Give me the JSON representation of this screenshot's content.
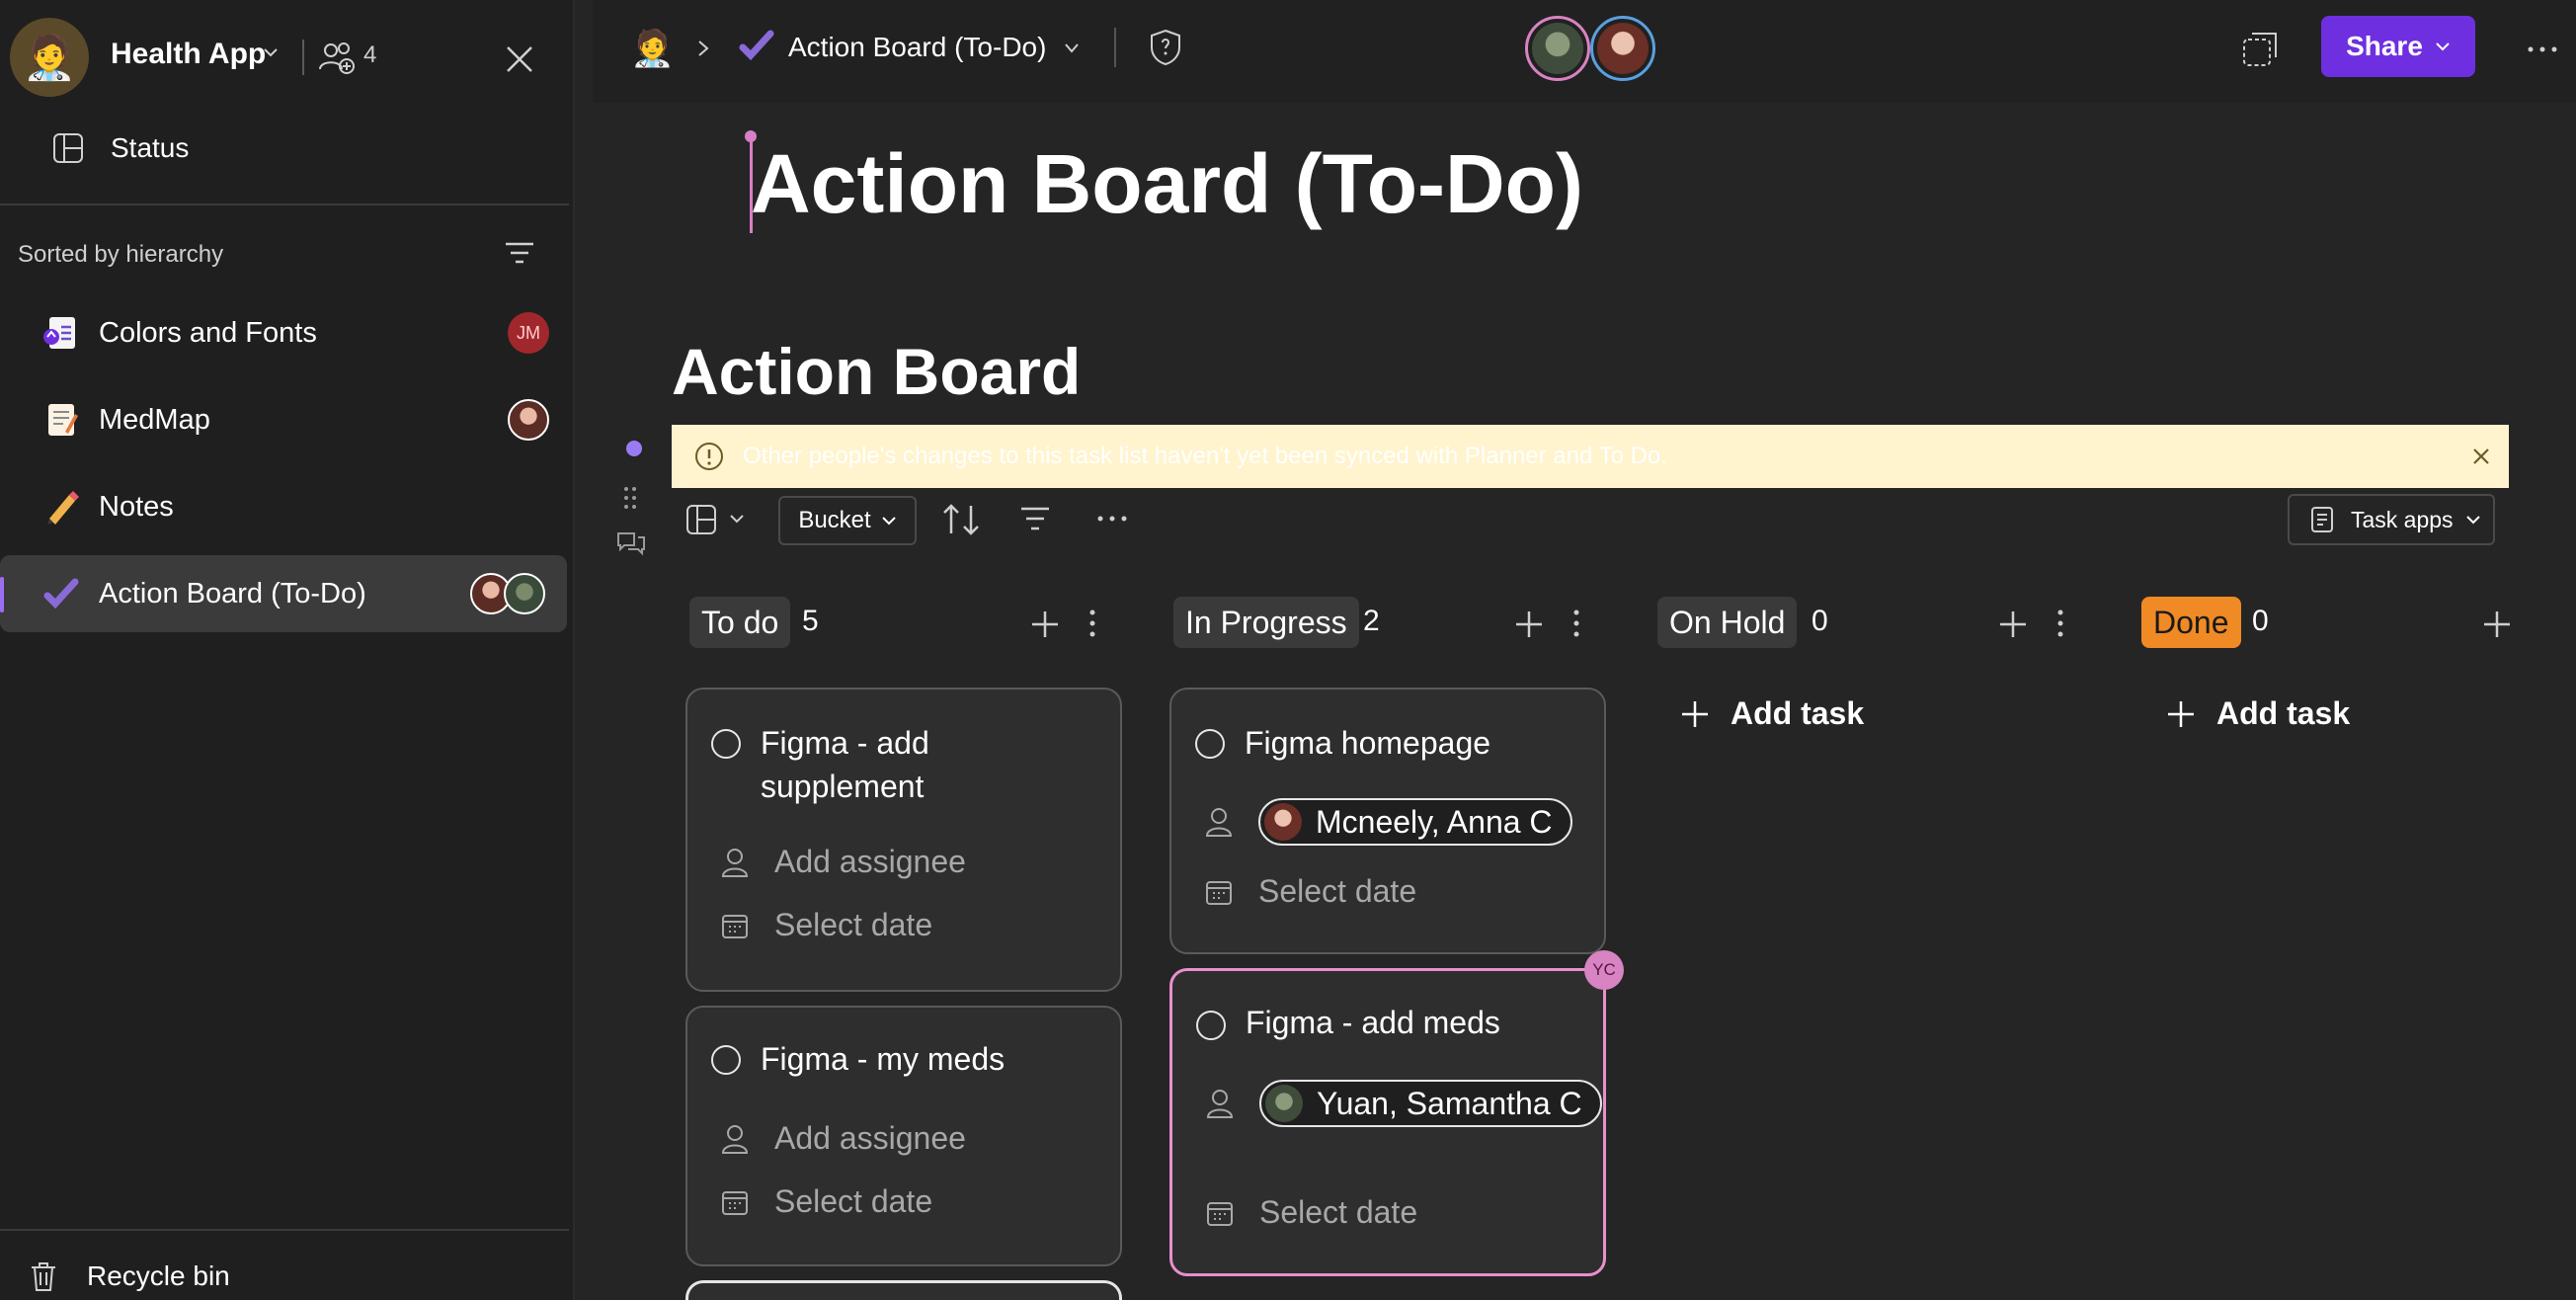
{
  "workspace": {
    "name": "Health App",
    "members_count": "4"
  },
  "sidebar": {
    "status_label": "Status",
    "sorted_label": "Sorted by hierarchy",
    "items": [
      {
        "label": "Colors and Fonts",
        "badge": "JM"
      },
      {
        "label": "MedMap"
      },
      {
        "label": "Notes"
      },
      {
        "label": "Action Board (To-Do)"
      }
    ],
    "recycle_label": "Recycle bin"
  },
  "topbar": {
    "page_title": "Action Board (To-Do)",
    "share_label": "Share"
  },
  "page": {
    "title": "Action Board (To-Do)",
    "heading": "Action Board"
  },
  "banner": {
    "message": "Other people's changes to this task list haven't yet been synced with Planner and To Do."
  },
  "toolbar": {
    "group_by": "Bucket",
    "task_apps": "Task apps"
  },
  "buckets": [
    {
      "name": "To do",
      "count": "5"
    },
    {
      "name": "In Progress",
      "count": "2"
    },
    {
      "name": "On Hold",
      "count": "0",
      "add_label": "Add task"
    },
    {
      "name": "Done",
      "count": "0",
      "add_label": "Add task",
      "color": "#f08a24"
    }
  ],
  "tasks": {
    "todo": [
      {
        "title": "Figma - add supplement",
        "assignee": "Add assignee",
        "date": "Select date"
      },
      {
        "title": "Figma - my meds",
        "assignee": "Add assignee",
        "date": "Select date"
      }
    ],
    "in_progress": [
      {
        "title": "Figma homepage",
        "assignee": "Mcneely, Anna C",
        "date": "Select date"
      },
      {
        "title": "Figma - add meds",
        "assignee": "Yuan, Samantha C",
        "date": "Select date",
        "editor_badge": "YC"
      }
    ]
  },
  "colors": {
    "accent": "#6e2fe0",
    "banner_bg": "#fff4ce",
    "highlight": "#e890cc"
  }
}
